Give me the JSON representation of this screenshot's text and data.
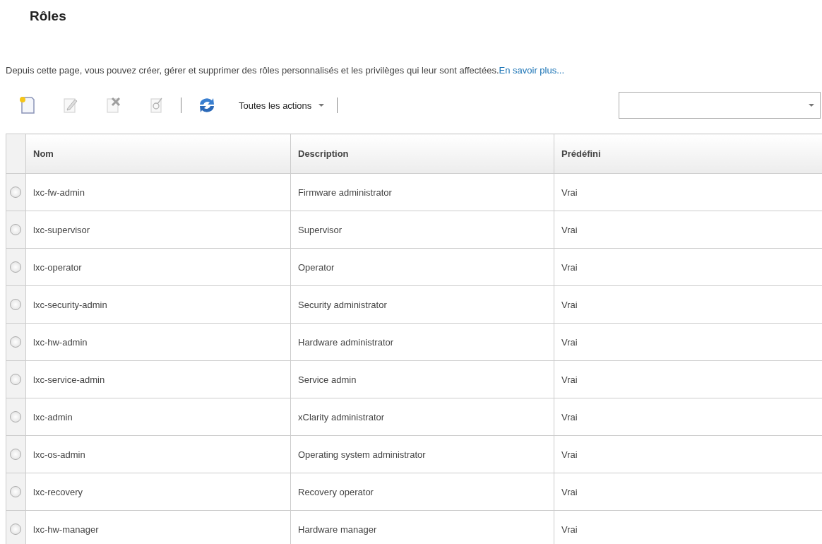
{
  "page": {
    "title": "Rôles",
    "description": "Depuis cette page, vous pouvez créer, gérer et supprimer des rôles personnalisés et les privilèges qui leur sont affectées.",
    "learn_more_link": "En savoir plus..."
  },
  "toolbar": {
    "tools": [
      {
        "kind": "create",
        "disabled": false
      },
      {
        "kind": "edit",
        "disabled": true
      },
      {
        "kind": "delete",
        "disabled": true
      },
      {
        "kind": "copy",
        "disabled": true
      },
      {
        "kind": "separator"
      },
      {
        "kind": "refresh",
        "disabled": false
      },
      {
        "kind": "separator"
      }
    ],
    "actions_menu": "Toutes les actions"
  },
  "table": {
    "columns": [
      "Nom",
      "Description",
      "Prédéfini"
    ],
    "rows": [
      {
        "cells": [
          "lxc-fw-admin",
          "Firmware administrator",
          "Vrai"
        ],
        "selected": false
      },
      {
        "cells": [
          "lxc-supervisor",
          "Supervisor",
          "Vrai"
        ],
        "selected": false
      },
      {
        "cells": [
          "lxc-operator",
          "Operator",
          "Vrai"
        ],
        "selected": false
      },
      {
        "cells": [
          "lxc-security-admin",
          "Security administrator",
          "Vrai"
        ],
        "selected": false
      },
      {
        "cells": [
          "lxc-hw-admin",
          "Hardware administrator",
          "Vrai"
        ],
        "selected": false
      },
      {
        "cells": [
          "lxc-service-admin",
          "Service admin",
          "Vrai"
        ],
        "selected": false
      },
      {
        "cells": [
          "lxc-admin",
          "xClarity administrator",
          "Vrai"
        ],
        "selected": false
      },
      {
        "cells": [
          "lxc-os-admin",
          "Operating system administrator",
          "Vrai"
        ],
        "selected": false
      },
      {
        "cells": [
          "lxc-recovery",
          "Recovery operator",
          "Vrai"
        ],
        "selected": false
      },
      {
        "cells": [
          "lxc-hw-manager",
          "Hardware manager",
          "Vrai"
        ],
        "selected": false
      }
    ]
  }
}
